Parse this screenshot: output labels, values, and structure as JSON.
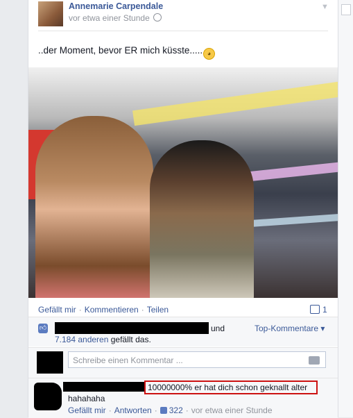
{
  "post": {
    "author": "Annemarie Carpendale",
    "time": "vor etwa einer Stunde",
    "message": "..der Moment, bevor ER mich küsste.....",
    "actions": {
      "like": "Gefällt mir",
      "comment": "Kommentieren",
      "share": "Teilen"
    },
    "comment_count": "1"
  },
  "likes": {
    "und": "und",
    "count_link": "7.184 anderen",
    "suffix": " gefällt das.",
    "top_comments": "Top-Kommentare ▾"
  },
  "composer": {
    "placeholder": "Schreibe einen Kommentar ..."
  },
  "comment": {
    "highlighted": "10000000% er hat dich schon geknallt alter",
    "text2": "hahahaha",
    "like": "Gefällt mir",
    "reply": "Antworten",
    "likes": "322",
    "time": "vor etwa einer Stunde"
  },
  "icons": {
    "chevron": "chevron-down-icon",
    "globe": "globe-icon",
    "emoji": "flushed-face-emoji",
    "camera": "camera-icon",
    "thumb": "thumbs-up-icon",
    "comment": "comment-icon"
  },
  "colors": {
    "link": "#3b5998",
    "highlight_border": "#cc1111"
  }
}
